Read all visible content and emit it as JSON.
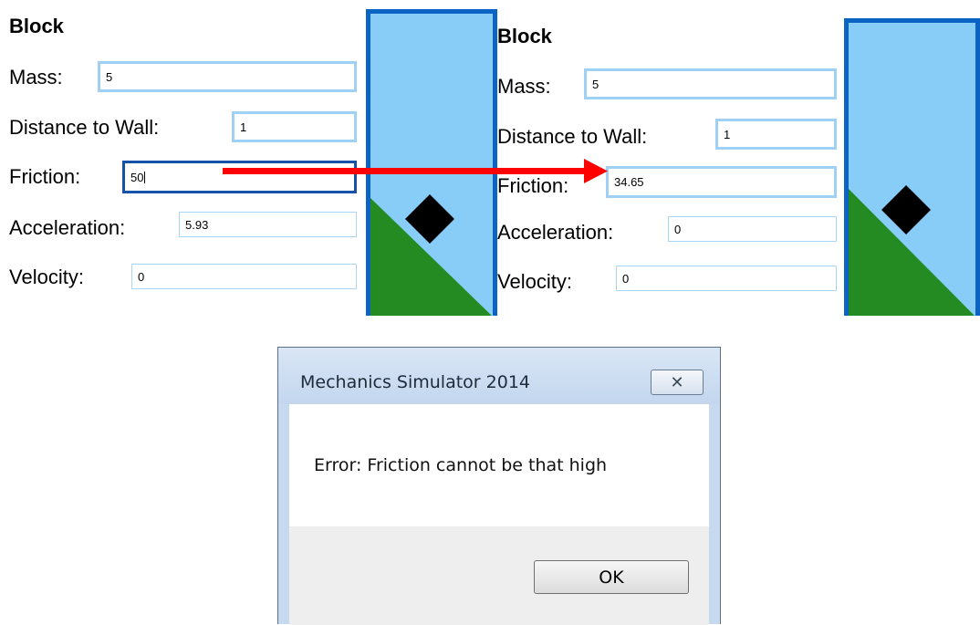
{
  "left_panel": {
    "title": "Block",
    "mass": {
      "label": "Mass:",
      "value": "5"
    },
    "distance": {
      "label": "Distance to Wall:",
      "value": "1"
    },
    "friction": {
      "label": "Friction:",
      "value": "50"
    },
    "acceleration": {
      "label": "Acceleration:",
      "value": "5.93"
    },
    "velocity": {
      "label": "Velocity:",
      "value": "0"
    }
  },
  "right_panel": {
    "title": "Block",
    "mass": {
      "label": "Mass:",
      "value": "5"
    },
    "distance": {
      "label": "Distance to Wall:",
      "value": "1"
    },
    "friction": {
      "label": "Friction:",
      "value": "34.65"
    },
    "acceleration": {
      "label": "Acceleration:",
      "value": "0"
    },
    "velocity": {
      "label": "Velocity:",
      "value": "0"
    }
  },
  "colors": {
    "sky": "#87cdf8",
    "ground": "#238b22",
    "block": "#000000",
    "frame": "#0b63c4",
    "arrow": "#ff0000"
  },
  "icons": {
    "arrow": "red-arrow",
    "close": "close-icon"
  },
  "dialog": {
    "title": "Mechanics Simulator 2014",
    "message": "Error: Friction cannot be that high",
    "ok_label": "OK",
    "close_glyph": "✕"
  }
}
